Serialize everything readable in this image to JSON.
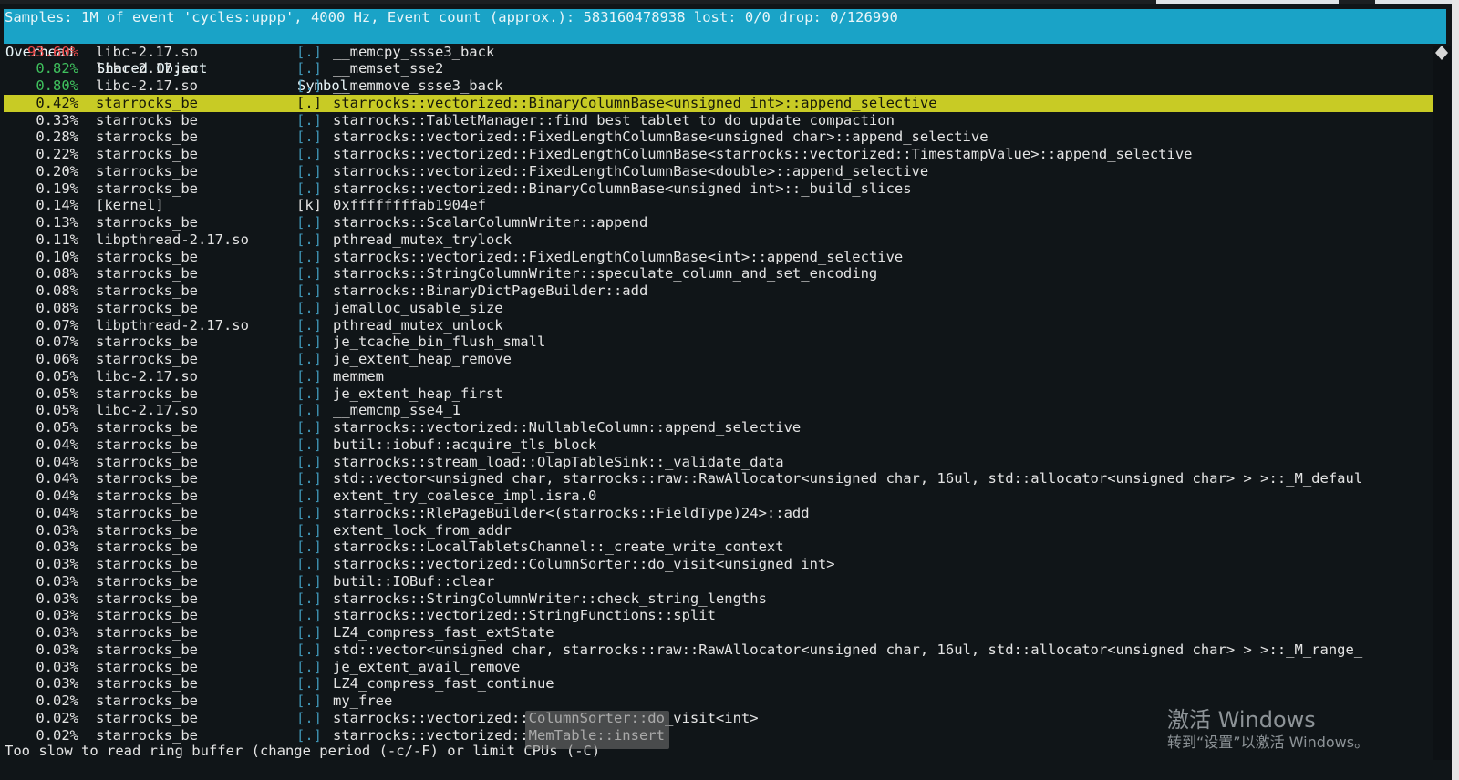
{
  "header": {
    "samples_line": "Samples: 1M of event 'cycles:uppp', 4000 Hz, Event count (approx.): 583160478938 lost: 0/0 drop: 0/126990",
    "columns": {
      "overhead": "Overhead",
      "shared_object": "Shared Object",
      "symbol": "Symbol"
    }
  },
  "rows": [
    {
      "overhead": "93.60%",
      "shared_object": "libc-2.17.so",
      "mode": "[.]",
      "symbol": "__memcpy_ssse3_back",
      "color": "red"
    },
    {
      "overhead": "0.82%",
      "shared_object": "libc-2.17.so",
      "mode": "[.]",
      "symbol": "__memset_sse2",
      "color": "green"
    },
    {
      "overhead": "0.80%",
      "shared_object": "libc-2.17.so",
      "mode": "[.]",
      "symbol": "__memmove_ssse3_back",
      "color": "green"
    },
    {
      "overhead": "0.42%",
      "shared_object": "starrocks_be",
      "mode": "[.]",
      "symbol": "starrocks::vectorized::BinaryColumnBase<unsigned int>::append_selective",
      "selected": true
    },
    {
      "overhead": "0.33%",
      "shared_object": "starrocks_be",
      "mode": "[.]",
      "symbol": "starrocks::TabletManager::find_best_tablet_to_do_update_compaction"
    },
    {
      "overhead": "0.28%",
      "shared_object": "starrocks_be",
      "mode": "[.]",
      "symbol": "starrocks::vectorized::FixedLengthColumnBase<unsigned char>::append_selective"
    },
    {
      "overhead": "0.22%",
      "shared_object": "starrocks_be",
      "mode": "[.]",
      "symbol": "starrocks::vectorized::FixedLengthColumnBase<starrocks::vectorized::TimestampValue>::append_selective"
    },
    {
      "overhead": "0.20%",
      "shared_object": "starrocks_be",
      "mode": "[.]",
      "symbol": "starrocks::vectorized::FixedLengthColumnBase<double>::append_selective"
    },
    {
      "overhead": "0.19%",
      "shared_object": "starrocks_be",
      "mode": "[.]",
      "symbol": "starrocks::vectorized::BinaryColumnBase<unsigned int>::_build_slices"
    },
    {
      "overhead": "0.14%",
      "shared_object": "[kernel]",
      "mode": "[k]",
      "symbol": "0xffffffffab1904ef",
      "kernel": true
    },
    {
      "overhead": "0.13%",
      "shared_object": "starrocks_be",
      "mode": "[.]",
      "symbol": "starrocks::ScalarColumnWriter::append"
    },
    {
      "overhead": "0.11%",
      "shared_object": "libpthread-2.17.so",
      "mode": "[.]",
      "symbol": "pthread_mutex_trylock"
    },
    {
      "overhead": "0.10%",
      "shared_object": "starrocks_be",
      "mode": "[.]",
      "symbol": "starrocks::vectorized::FixedLengthColumnBase<int>::append_selective"
    },
    {
      "overhead": "0.08%",
      "shared_object": "starrocks_be",
      "mode": "[.]",
      "symbol": "starrocks::StringColumnWriter::speculate_column_and_set_encoding"
    },
    {
      "overhead": "0.08%",
      "shared_object": "starrocks_be",
      "mode": "[.]",
      "symbol": "starrocks::BinaryDictPageBuilder::add"
    },
    {
      "overhead": "0.08%",
      "shared_object": "starrocks_be",
      "mode": "[.]",
      "symbol": "jemalloc_usable_size"
    },
    {
      "overhead": "0.07%",
      "shared_object": "libpthread-2.17.so",
      "mode": "[.]",
      "symbol": "pthread_mutex_unlock"
    },
    {
      "overhead": "0.07%",
      "shared_object": "starrocks_be",
      "mode": "[.]",
      "symbol": "je_tcache_bin_flush_small"
    },
    {
      "overhead": "0.06%",
      "shared_object": "starrocks_be",
      "mode": "[.]",
      "symbol": "je_extent_heap_remove"
    },
    {
      "overhead": "0.05%",
      "shared_object": "libc-2.17.so",
      "mode": "[.]",
      "symbol": "memmem"
    },
    {
      "overhead": "0.05%",
      "shared_object": "starrocks_be",
      "mode": "[.]",
      "symbol": "je_extent_heap_first"
    },
    {
      "overhead": "0.05%",
      "shared_object": "libc-2.17.so",
      "mode": "[.]",
      "symbol": "__memcmp_sse4_1"
    },
    {
      "overhead": "0.05%",
      "shared_object": "starrocks_be",
      "mode": "[.]",
      "symbol": "starrocks::vectorized::NullableColumn::append_selective"
    },
    {
      "overhead": "0.04%",
      "shared_object": "starrocks_be",
      "mode": "[.]",
      "symbol": "butil::iobuf::acquire_tls_block"
    },
    {
      "overhead": "0.04%",
      "shared_object": "starrocks_be",
      "mode": "[.]",
      "symbol": "starrocks::stream_load::OlapTableSink::_validate_data"
    },
    {
      "overhead": "0.04%",
      "shared_object": "starrocks_be",
      "mode": "[.]",
      "symbol": "std::vector<unsigned char, starrocks::raw::RawAllocator<unsigned char, 16ul, std::allocator<unsigned char> > >::_M_defaul"
    },
    {
      "overhead": "0.04%",
      "shared_object": "starrocks_be",
      "mode": "[.]",
      "symbol": "extent_try_coalesce_impl.isra.0"
    },
    {
      "overhead": "0.04%",
      "shared_object": "starrocks_be",
      "mode": "[.]",
      "symbol": "starrocks::RlePageBuilder<(starrocks::FieldType)24>::add"
    },
    {
      "overhead": "0.03%",
      "shared_object": "starrocks_be",
      "mode": "[.]",
      "symbol": "extent_lock_from_addr"
    },
    {
      "overhead": "0.03%",
      "shared_object": "starrocks_be",
      "mode": "[.]",
      "symbol": "starrocks::LocalTabletsChannel::_create_write_context"
    },
    {
      "overhead": "0.03%",
      "shared_object": "starrocks_be",
      "mode": "[.]",
      "symbol": "starrocks::vectorized::ColumnSorter::do_visit<unsigned int>"
    },
    {
      "overhead": "0.03%",
      "shared_object": "starrocks_be",
      "mode": "[.]",
      "symbol": "butil::IOBuf::clear"
    },
    {
      "overhead": "0.03%",
      "shared_object": "starrocks_be",
      "mode": "[.]",
      "symbol": "starrocks::StringColumnWriter::check_string_lengths"
    },
    {
      "overhead": "0.03%",
      "shared_object": "starrocks_be",
      "mode": "[.]",
      "symbol": "starrocks::vectorized::StringFunctions::split"
    },
    {
      "overhead": "0.03%",
      "shared_object": "starrocks_be",
      "mode": "[.]",
      "symbol": "LZ4_compress_fast_extState"
    },
    {
      "overhead": "0.03%",
      "shared_object": "starrocks_be",
      "mode": "[.]",
      "symbol": "std::vector<unsigned char, starrocks::raw::RawAllocator<unsigned char, 16ul, std::allocator<unsigned char> > >::_M_range_"
    },
    {
      "overhead": "0.03%",
      "shared_object": "starrocks_be",
      "mode": "[.]",
      "symbol": "je_extent_avail_remove"
    },
    {
      "overhead": "0.03%",
      "shared_object": "starrocks_be",
      "mode": "[.]",
      "symbol": "LZ4_compress_fast_continue"
    },
    {
      "overhead": "0.02%",
      "shared_object": "starrocks_be",
      "mode": "[.]",
      "symbol": "my_free"
    },
    {
      "overhead": "0.02%",
      "shared_object": "starrocks_be",
      "mode": "[.]",
      "symbol": "starrocks::vectorized::ColumnSorter::do_visit<int>"
    },
    {
      "overhead": "0.02%",
      "shared_object": "starrocks_be",
      "mode": "[.]",
      "symbol": "starrocks::vectorized::MemTable::insert"
    }
  ],
  "status_line": "Too slow to read ring buffer (change period (-c/-F) or limit CPUs (-C)",
  "activation": {
    "title": "激活 Windows",
    "subtitle": "转到“设置”以激活 Windows。"
  },
  "colors": {
    "header_bg": "#1aa3c7",
    "selected_bg": "#c8cb25",
    "hot_red": "#ef4b4b",
    "warm_green": "#3fc05d",
    "mode_blue": "#3f93b3",
    "terminal_bg": "#101518"
  }
}
